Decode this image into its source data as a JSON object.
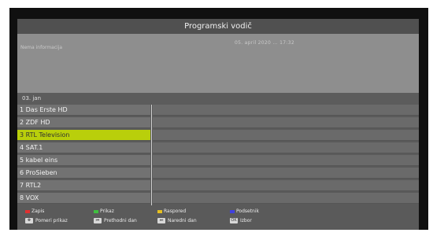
{
  "epg": {
    "title": "Programski vodič",
    "info_left": "Nema informacija",
    "info_right": "05. april 2020 ... 17:32",
    "date_label": "03. jan",
    "channels": [
      "1 Das Erste HD",
      "2 ZDF HD",
      "3 RTL Television",
      "4 SAT.1",
      "5 kabel eins",
      "6 ProSieben",
      "7 RTL2",
      "8 VOX"
    ],
    "selected_index": 2
  },
  "footer": {
    "rec": "Zapis",
    "show": "Prikaz",
    "schedule": "Raspored",
    "reminder": "Podsetnik",
    "move_display": "Pomeri prikaz",
    "prev_day": "Prethodni dan",
    "next_day": "Naredni dan",
    "select": "Izbor",
    "colors": {
      "red": "#e03030",
      "green": "#3fbf3f",
      "yellow": "#e6c020",
      "blue": "#4040e0"
    }
  }
}
